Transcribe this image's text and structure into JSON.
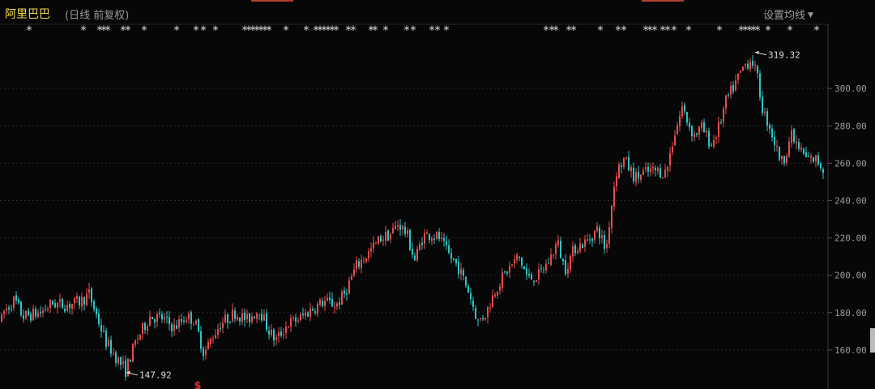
{
  "header": {
    "stock_name": "阿里巴巴",
    "subtitle": "(日线 前复权)",
    "settings_label": "设置均线"
  },
  "colors": {
    "background": "#070707",
    "up": "#e74c4c",
    "down": "#2bc6c6",
    "grid": "#2a2a2a",
    "axis_text": "#9a9a9a",
    "title": "#f2d94e",
    "marker": "#e0e0e0",
    "signal": "#e23030"
  },
  "chart_data": {
    "type": "candlestick",
    "ylim": [
      140,
      330
    ],
    "yticks": [
      160,
      180,
      200,
      220,
      240,
      260,
      280,
      300
    ],
    "ytick_labels": [
      "160.00",
      "180.00",
      "200.00",
      "220.00",
      "240.00",
      "260.00",
      "280.00",
      "300.00"
    ],
    "price_path": [
      [
        0,
        172
      ],
      [
        4,
        180
      ],
      [
        18,
        187
      ],
      [
        28,
        178
      ],
      [
        50,
        180
      ],
      [
        64,
        185
      ],
      [
        82,
        184
      ],
      [
        100,
        186
      ],
      [
        110,
        190
      ],
      [
        118,
        180
      ],
      [
        130,
        165
      ],
      [
        145,
        155
      ],
      [
        155,
        149
      ],
      [
        168,
        165
      ],
      [
        185,
        178
      ],
      [
        200,
        177
      ],
      [
        215,
        172
      ],
      [
        230,
        178
      ],
      [
        240,
        176
      ],
      [
        252,
        158
      ],
      [
        262,
        167
      ],
      [
        272,
        174
      ],
      [
        290,
        180
      ],
      [
        305,
        176
      ],
      [
        320,
        182
      ],
      [
        330,
        172
      ],
      [
        340,
        165
      ],
      [
        355,
        174
      ],
      [
        370,
        177
      ],
      [
        385,
        182
      ],
      [
        400,
        186
      ],
      [
        415,
        184
      ],
      [
        425,
        190
      ],
      [
        440,
        205
      ],
      [
        455,
        212
      ],
      [
        470,
        220
      ],
      [
        482,
        222
      ],
      [
        492,
        228
      ],
      [
        502,
        222
      ],
      [
        512,
        208
      ],
      [
        522,
        221
      ],
      [
        532,
        222
      ],
      [
        542,
        220
      ],
      [
        552,
        212
      ],
      [
        565,
        205
      ],
      [
        578,
        192
      ],
      [
        590,
        175
      ],
      [
        600,
        180
      ],
      [
        612,
        193
      ],
      [
        625,
        202
      ],
      [
        640,
        210
      ],
      [
        652,
        198
      ],
      [
        665,
        200
      ],
      [
        678,
        208
      ],
      [
        688,
        218
      ],
      [
        697,
        203
      ],
      [
        710,
        215
      ],
      [
        724,
        218
      ],
      [
        738,
        225
      ],
      [
        748,
        213
      ],
      [
        752,
        228
      ],
      [
        760,
        255
      ],
      [
        770,
        262
      ],
      [
        784,
        252
      ],
      [
        796,
        255
      ],
      [
        808,
        256
      ],
      [
        822,
        255
      ],
      [
        832,
        275
      ],
      [
        842,
        290
      ],
      [
        848,
        283
      ],
      [
        856,
        275
      ],
      [
        866,
        279
      ],
      [
        878,
        270
      ],
      [
        888,
        280
      ],
      [
        896,
        293
      ],
      [
        908,
        303
      ],
      [
        918,
        312
      ],
      [
        928,
        316
      ],
      [
        935,
        305
      ],
      [
        942,
        287
      ],
      [
        950,
        280
      ],
      [
        958,
        268
      ],
      [
        966,
        260
      ],
      [
        976,
        275
      ],
      [
        986,
        268
      ],
      [
        996,
        262
      ],
      [
        1008,
        262
      ],
      [
        1016,
        257
      ]
    ],
    "annotations": [
      {
        "label": "319.32",
        "x_index": 932,
        "price": 319.32
      },
      {
        "label": "147.92",
        "x_index": 156,
        "price": 147.92
      }
    ],
    "signal_marks": [
      {
        "label": "$",
        "x_index": 244
      }
    ],
    "star_x_positions": [
      36,
      103,
      123,
      128,
      133,
      152,
      158,
      178,
      218,
      242,
      251,
      266,
      302,
      307,
      312,
      317,
      322,
      327,
      332,
      353,
      378,
      390,
      395,
      400,
      405,
      410,
      415,
      430,
      436,
      458,
      463,
      476,
      502,
      510,
      533,
      540,
      551,
      674,
      681,
      686,
      702,
      708,
      741,
      763,
      770,
      797,
      802,
      808,
      818,
      824,
      832,
      850,
      888,
      915,
      920,
      925,
      930,
      935,
      948,
      975,
      1008
    ],
    "marker_glyph": "*"
  }
}
